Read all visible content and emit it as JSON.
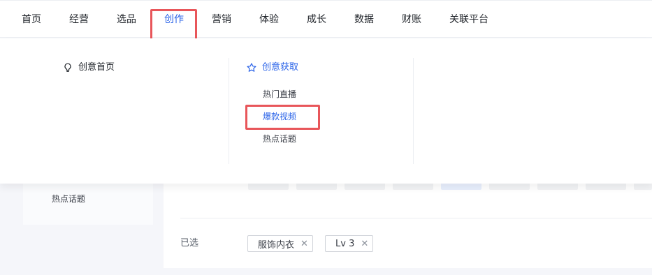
{
  "nav": {
    "items": [
      {
        "label": "首页"
      },
      {
        "label": "经营"
      },
      {
        "label": "选品"
      },
      {
        "label": "创作"
      },
      {
        "label": "营销"
      },
      {
        "label": "体验"
      },
      {
        "label": "成长"
      },
      {
        "label": "数据"
      },
      {
        "label": "财账"
      },
      {
        "label": "关联平台"
      }
    ],
    "active_index": 3
  },
  "dropdown": {
    "col1": {
      "title": "创意首页",
      "icon": "lightbulb-icon"
    },
    "col2": {
      "title": "创意获取",
      "icon": "star-icon",
      "items": [
        {
          "label": "热门直播"
        },
        {
          "label": "爆款视频"
        },
        {
          "label": "热点话题"
        }
      ],
      "active_index": 1
    }
  },
  "sidebar": {
    "items": [
      {
        "label": "热点话题"
      }
    ]
  },
  "filters": {
    "selected_label": "已选",
    "selected_tags": [
      {
        "label": "服饰内衣"
      },
      {
        "label": "Lv 3"
      }
    ],
    "remove_glyph": "✕"
  },
  "colors": {
    "accent": "#2a63e8",
    "highlight": "#e8565a"
  }
}
